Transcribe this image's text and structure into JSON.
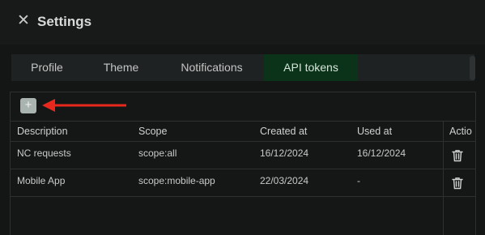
{
  "header": {
    "title": "Settings",
    "close_icon": "close-icon"
  },
  "tabs": [
    {
      "label": "Profile",
      "active": false
    },
    {
      "label": "Theme",
      "active": false
    },
    {
      "label": "Notifications",
      "active": false
    },
    {
      "label": "API tokens",
      "active": true
    }
  ],
  "toolbar": {
    "add_icon_glyph": "+",
    "add_icon": "plus-icon"
  },
  "table": {
    "columns": [
      "Description",
      "Scope",
      "Created at",
      "Used at",
      "Actio"
    ],
    "rows": [
      {
        "description": "NC requests",
        "scope": "scope:all",
        "created": "16/12/2024",
        "used": "16/12/2024",
        "action_icon": "trash-icon"
      },
      {
        "description": "Mobile App",
        "scope": "scope:mobile-app",
        "created": "22/03/2024",
        "used": "-",
        "action_icon": "trash-icon"
      }
    ]
  },
  "colors": {
    "active_tab": "#0a331a",
    "annotation_arrow": "#e8281c",
    "background": "#141616"
  }
}
